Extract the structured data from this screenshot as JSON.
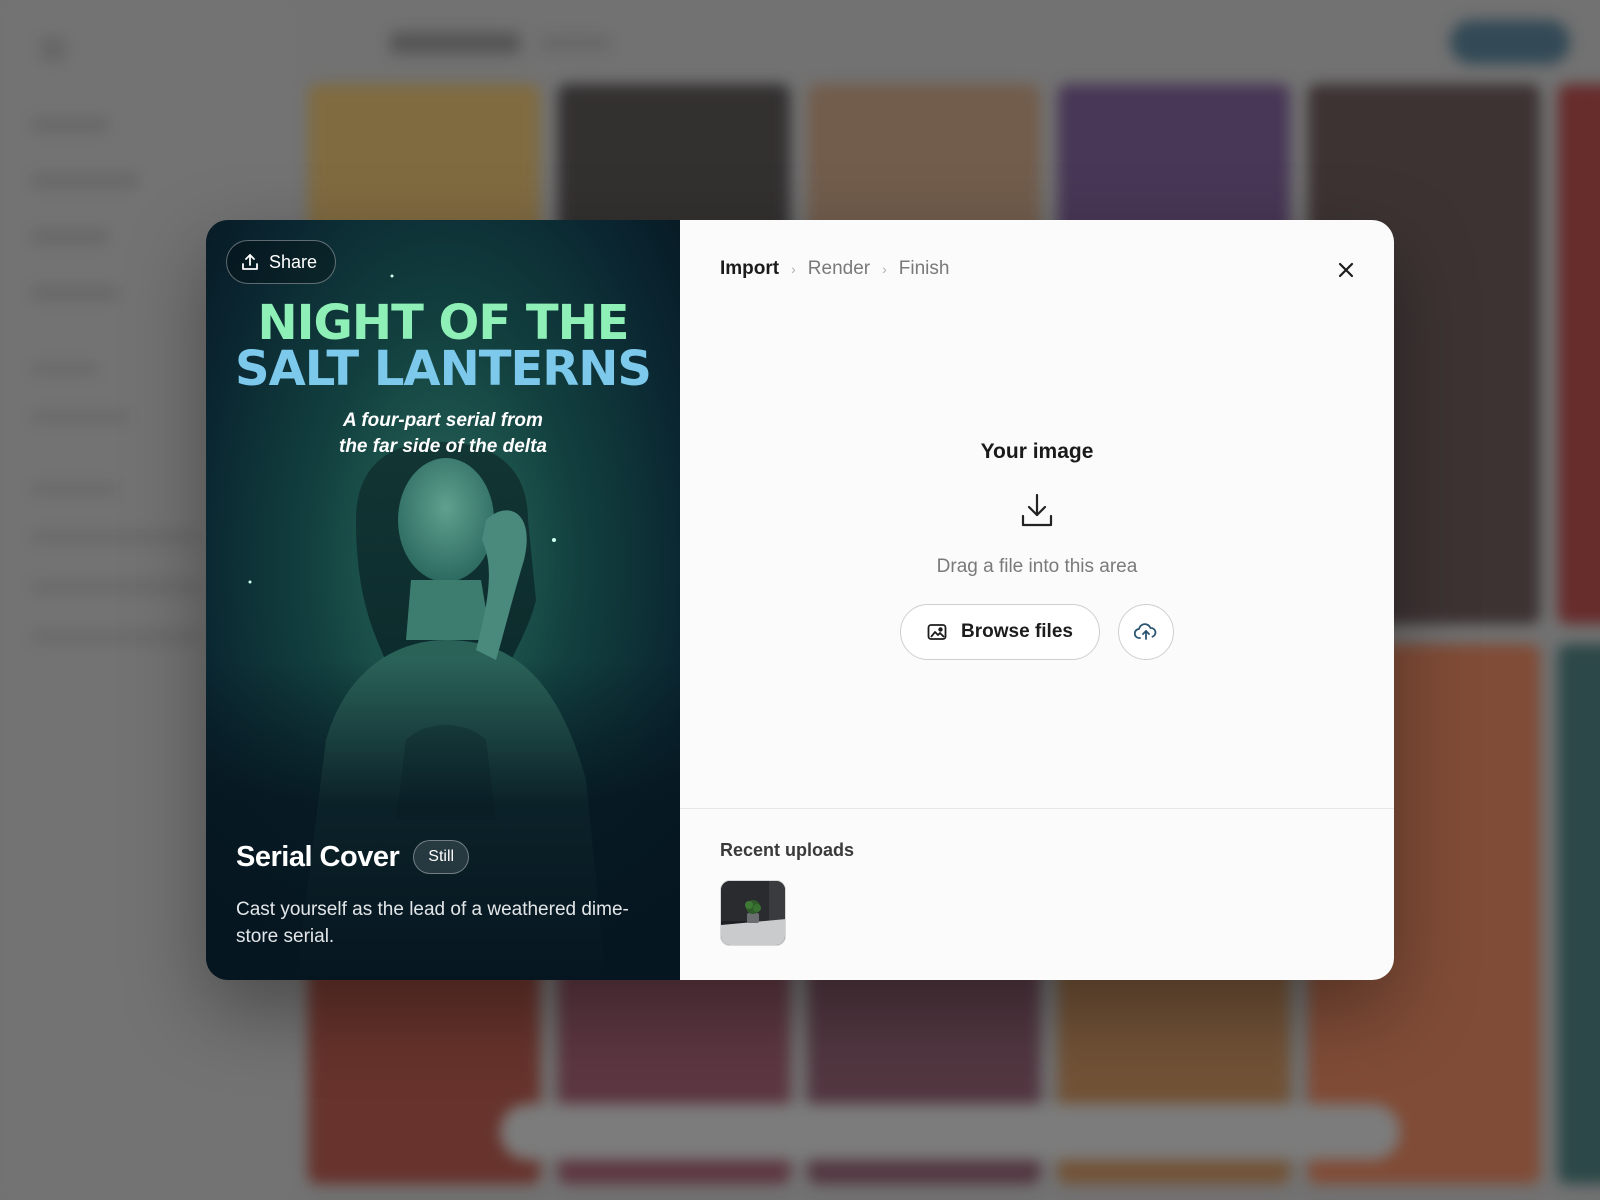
{
  "modal": {
    "share_label": "Share",
    "poster": {
      "title_line1": "NIGHT OF THE",
      "title_line2": "SALT LANTERNS",
      "tagline_line1": "A four-part serial from",
      "tagline_line2": "the far side of the delta"
    },
    "card": {
      "title": "Serial Cover",
      "badge": "Still",
      "description": "Cast yourself as the lead of a weathered dime-store serial."
    },
    "steps": [
      {
        "label": "Import",
        "active": true
      },
      {
        "label": "Render",
        "active": false
      },
      {
        "label": "Finish",
        "active": false
      }
    ],
    "upload": {
      "title": "Your image",
      "hint": "Drag a file into this area",
      "browse_label": "Browse files"
    },
    "recent": {
      "label": "Recent uploads"
    }
  },
  "colors": {
    "title_line1": "#8ef0b6",
    "title_line2": "#7cc9ec",
    "poster_bg": "#0a2530",
    "panel_bg": "#fbfbfb"
  },
  "icons": {
    "share": "share-upload-icon",
    "close": "close-icon",
    "download": "download-icon",
    "browse": "image-icon",
    "cloud": "cloud-upload-icon"
  }
}
